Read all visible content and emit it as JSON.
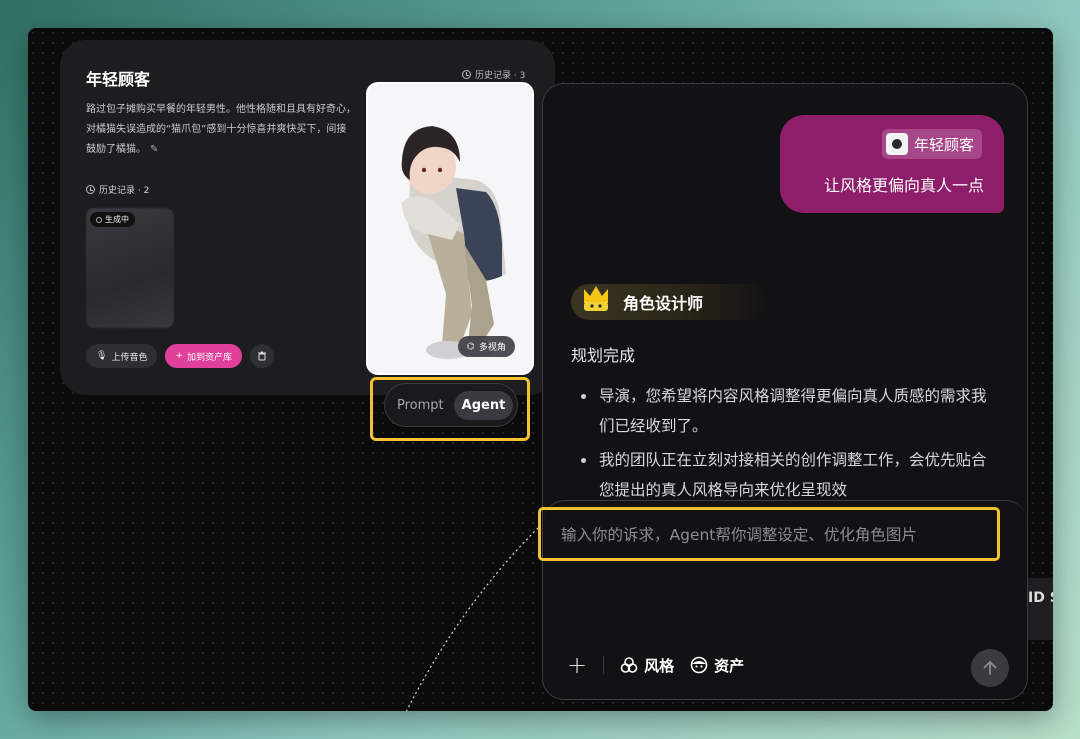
{
  "character": {
    "name": "年轻顾客",
    "history_top": "历史记录 · 3",
    "description": "路过包子摊购买早餐的年轻男性。他性格随和且具有好奇心，对橘猫失误造成的“猫爪包”感到十分惊喜并爽快买下，间接鼓励了橘猫。",
    "history2": "历史记录 · 2",
    "generating": "生成中",
    "upload_voice": "上传音色",
    "add_to_assets": "加到资产库",
    "multi_view": "多视角"
  },
  "mode_toggle": {
    "options": [
      "Prompt",
      "Agent"
    ],
    "active": "Agent"
  },
  "chat": {
    "user_tag": "年轻顾客",
    "user_message": "让风格更偏向真人一点",
    "agent_name": "角色设计师",
    "plan_status": "规划完成",
    "bullets": [
      "导演，您希望将内容风格调整得更偏向真人质感的需求我们已经收到了。",
      "我的团队正在立刻对接相关的创作调整工作，会优先贴合您提出的真人风格导向来优化呈现效"
    ],
    "input_placeholder": "输入你的诉求，Agent帮你调整设定、优化角色图片",
    "tools": {
      "style": "风格",
      "assets": "资产"
    },
    "side_peek_text": "ID S"
  },
  "colors": {
    "user_bubble": "#8e1d6a",
    "highlight": "#f2c230",
    "pink_button": "#e0409a"
  }
}
